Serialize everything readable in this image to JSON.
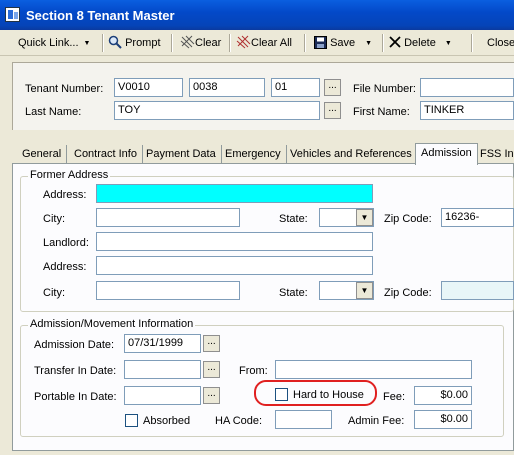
{
  "window": {
    "title": "Section 8 Tenant Master"
  },
  "toolbar": {
    "quick_link": "Quick Link...",
    "prompt": "Prompt",
    "clear": "Clear",
    "clear_all": "Clear All",
    "save": "Save",
    "delete": "Delete",
    "close": "Close"
  },
  "header": {
    "tenant_number_label": "Tenant Number:",
    "tenant_number_1": "V0010",
    "tenant_number_2": "0038",
    "tenant_number_3": "01",
    "file_number_label": "File Number:",
    "file_number": "",
    "last_name_label": "Last Name:",
    "last_name": "TOY",
    "first_name_label": "First Name:",
    "first_name": "TINKER"
  },
  "tabs": [
    "General",
    "Contract Info",
    "Payment Data",
    "Emergency",
    "Vehicles and References",
    "Admission",
    "FSS In"
  ],
  "active_tab": "Admission",
  "former_address": {
    "legend": "Former Address",
    "address_label": "Address:",
    "address": "",
    "city_label": "City:",
    "city": "",
    "state_label": "State:",
    "state": "",
    "zip_label": "Zip Code:",
    "zip": "16236-",
    "landlord_label": "Landlord:",
    "landlord": "",
    "landlord_address_label": "Address:",
    "landlord_address": "",
    "landlord_city_label": "City:",
    "landlord_city": "",
    "landlord_state_label": "State:",
    "landlord_state": "",
    "landlord_zip_label": "Zip Code:",
    "landlord_zip": ""
  },
  "admission": {
    "legend": "Admission/Movement Information",
    "admission_date_label": "Admission Date:",
    "admission_date": "07/31/1999",
    "transfer_in_date_label": "Transfer In Date:",
    "transfer_in_date": "",
    "from_label": "From:",
    "from": "",
    "portable_in_date_label": "Portable In Date:",
    "portable_in_date": "",
    "hard_to_house_label": "Hard to House",
    "hard_to_house_checked": false,
    "fee_label": "Fee:",
    "fee": "$0.00",
    "absorbed_label": "Absorbed",
    "absorbed_checked": false,
    "ha_code_label": "HA Code:",
    "ha_code": "",
    "admin_fee_label": "Admin Fee:",
    "admin_fee": "$0.00"
  },
  "colors": {
    "title_bar": "#0349c9",
    "required_field": "#00ffff",
    "highlight_ring": "#e02020"
  }
}
